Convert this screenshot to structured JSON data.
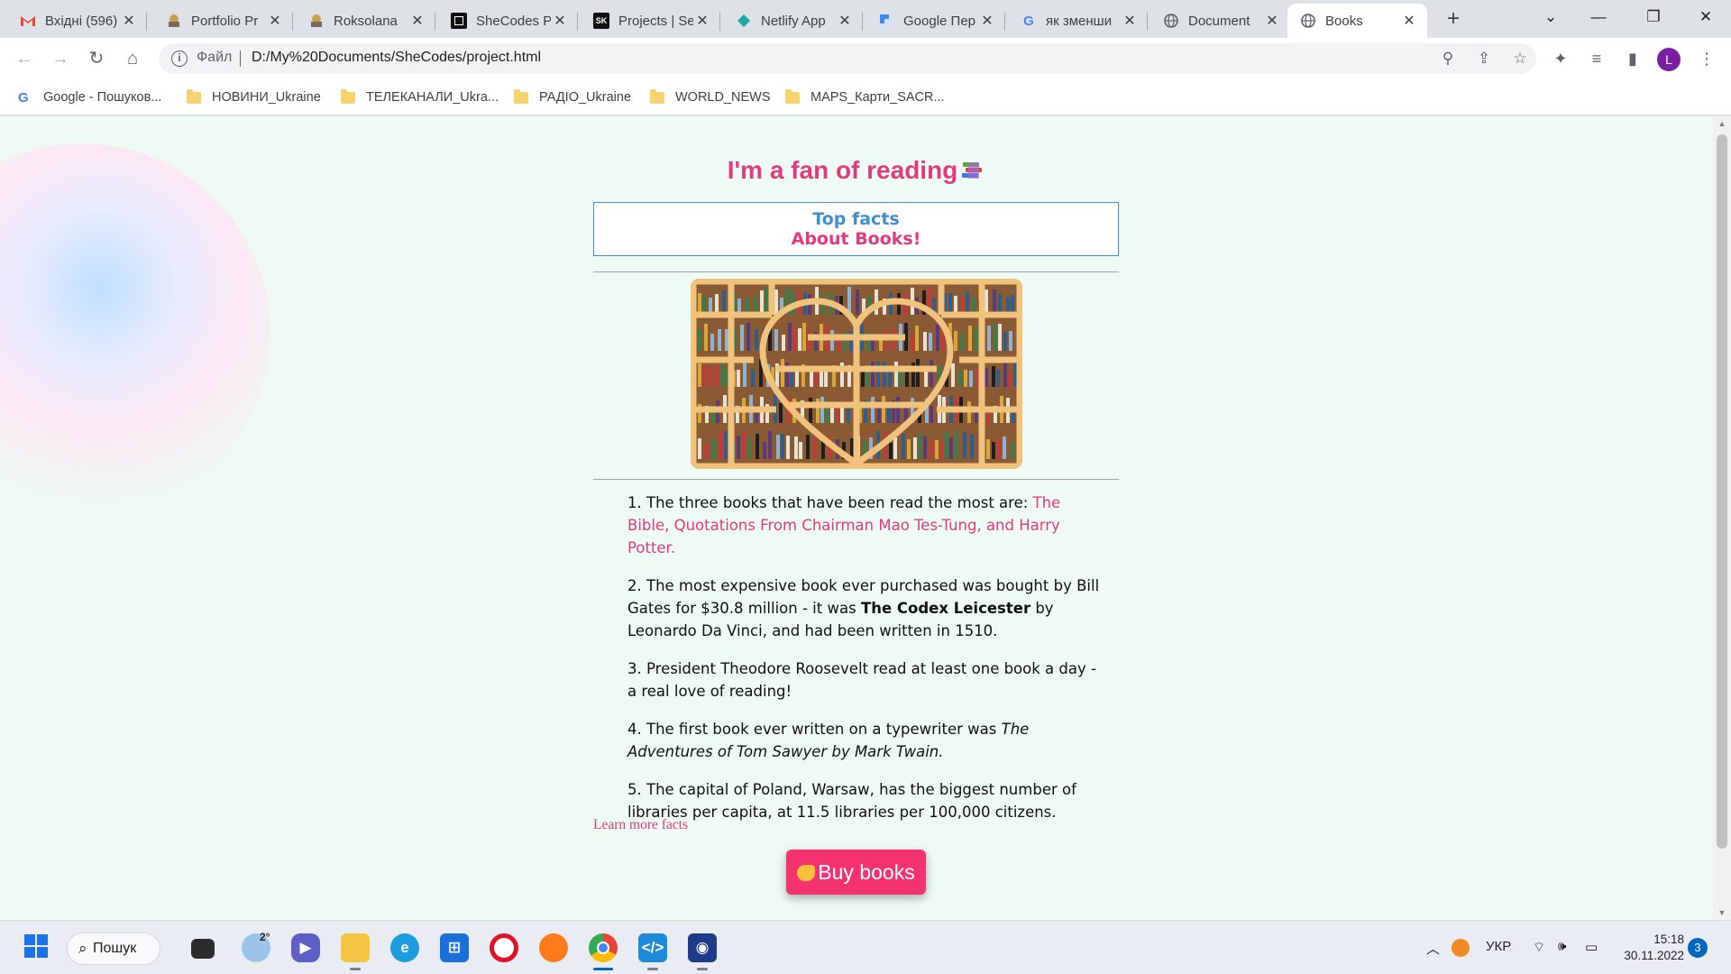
{
  "browser": {
    "tabs": [
      {
        "title": "Вхідні (596)",
        "icon": "gmail-icon",
        "active": false
      },
      {
        "title": "Portfolio Pr",
        "icon": "tab-favicon-icon",
        "active": false
      },
      {
        "title": "Roksolana",
        "icon": "tab-favicon-icon",
        "active": false
      },
      {
        "title": "SheCodes P",
        "icon": "shecodes-icon",
        "active": false
      },
      {
        "title": "Projects | Se",
        "icon": "sk-icon",
        "active": false
      },
      {
        "title": "Netlify App",
        "icon": "netlify-icon",
        "active": false
      },
      {
        "title": "Google Пер",
        "icon": "google-translate-icon",
        "active": false
      },
      {
        "title": "як зменши",
        "icon": "google-icon",
        "active": false
      },
      {
        "title": "Document",
        "icon": "globe-icon",
        "active": false
      },
      {
        "title": "Books",
        "icon": "globe-icon",
        "active": true
      }
    ],
    "address": {
      "scheme_label": "Файл",
      "url": "D:/My%20Documents/SheCodes/project.html"
    },
    "profile_initial": "L",
    "bookmarks": [
      {
        "label": "Google - Пошуков...",
        "icon": "google-icon"
      },
      {
        "label": "НОВИНИ_Ukraine",
        "icon": "folder-icon"
      },
      {
        "label": "ТЕЛЕКАНАЛИ_Ukra...",
        "icon": "folder-icon"
      },
      {
        "label": "РАДІО_Ukraine",
        "icon": "folder-icon"
      },
      {
        "label": "WORLD_NEWS",
        "icon": "folder-icon"
      },
      {
        "label": "MAPS_Карти_SACR...",
        "icon": "folder-icon"
      }
    ]
  },
  "page": {
    "title": "I'm a fan of reading",
    "facts_box": {
      "line1": "Top facts",
      "line2": "About Books!"
    },
    "facts": [
      {
        "num": "1.",
        "text": "The three books that have been read the most are: ",
        "highlight": "The Bible, Quotations From Chairman Mao Tes-Tung, and Harry Potter."
      },
      {
        "num": "2.",
        "text_before": "The most expensive book ever purchased was bought by Bill Gates for $30.8 million - it was ",
        "bold": "The Codex Leicester",
        "text_after": " by Leonardo Da Vinci, and had been written in 1510."
      },
      {
        "num": "3.",
        "text": "President Theodore Roosevelt read at least one book a day - a real love of reading!"
      },
      {
        "num": "4.",
        "text": "The first book ever written on a typewriter was ",
        "italic": "The Adventures of Tom Sawyer by Mark Twain."
      },
      {
        "num": "5.",
        "text": "The capital of Poland, Warsaw, has the biggest number of libraries per capita, at 11.5 libraries per 100,000 citizens."
      }
    ],
    "learn_more": "Learn more facts",
    "buy_button": "Buy books",
    "colors": {
      "accent_pink": "#e13b7c",
      "accent_blue": "#3e8ed0",
      "button": "#f4326f",
      "background": "#eefaf4"
    }
  },
  "taskbar": {
    "search_label": "Пошук",
    "weather_temp": "2°",
    "language": "УКР",
    "time": "15:18",
    "date": "30.11.2022",
    "notification_count": "3"
  }
}
